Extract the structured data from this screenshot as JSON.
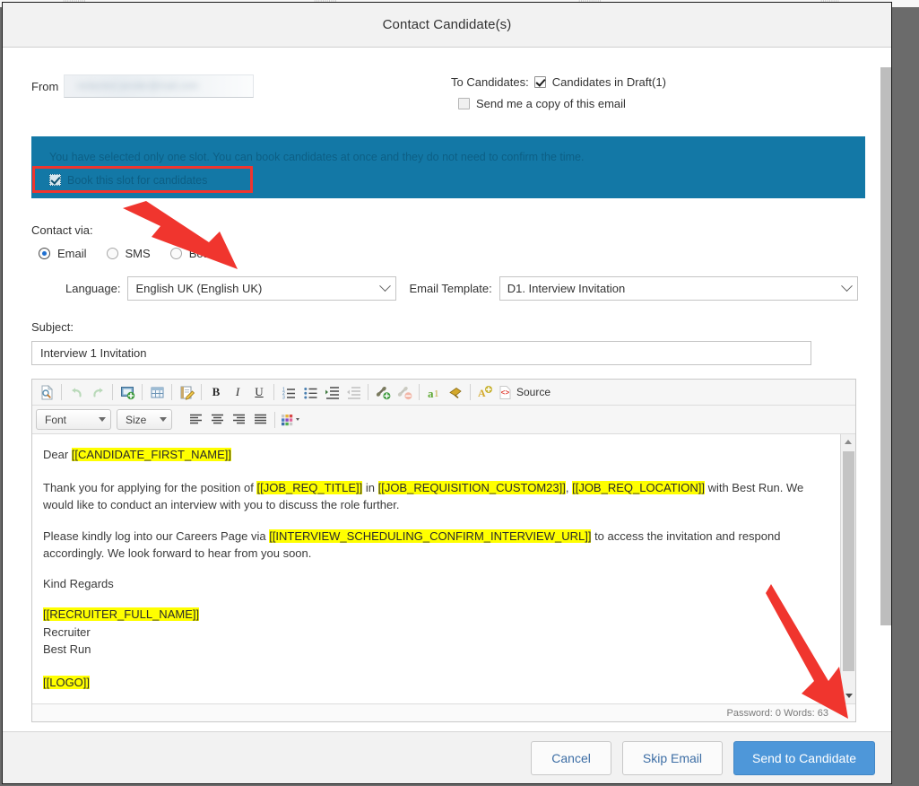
{
  "modal": {
    "title": "Contact Candidate(s)"
  },
  "from": {
    "label": "From",
    "value_redacted": "redacted.sender@mail.com"
  },
  "recipients": {
    "to_label": "To Candidates:",
    "candidates_option": "Candidates in Draft(1)",
    "candidates_checked": true,
    "copy_option": "Send me a copy of this email",
    "copy_checked": false
  },
  "info_banner": {
    "message": "You have selected only one slot. You can book candidates at once and they do not need to confirm the time.",
    "checkbox_label": "Book this slot for candidates",
    "checkbox_checked": true,
    "background_color": "#1378a6",
    "highlight_color": "#f0352e"
  },
  "contact_via": {
    "label": "Contact via:",
    "options": [
      {
        "label": "Email",
        "selected": true
      },
      {
        "label": "SMS",
        "selected": false
      },
      {
        "label": "Both",
        "selected": false
      }
    ]
  },
  "language": {
    "label": "Language:",
    "value": "English UK (English UK)"
  },
  "template": {
    "label": "Email Template:",
    "value": "D1. Interview Invitation"
  },
  "subject": {
    "label": "Subject:",
    "value": "Interview 1 Invitation"
  },
  "editor": {
    "toolbar_row1": [
      {
        "name": "preview-icon",
        "glyph": ""
      },
      {
        "name": "undo-icon",
        "glyph": ""
      },
      {
        "name": "redo-icon",
        "glyph": ""
      },
      {
        "name": "insert-image-icon",
        "glyph": ""
      },
      {
        "name": "insert-table-icon",
        "glyph": ""
      },
      {
        "name": "edit-template-icon",
        "glyph": ""
      },
      {
        "name": "bold-icon",
        "glyph": "B"
      },
      {
        "name": "italic-icon",
        "glyph": "I"
      },
      {
        "name": "underline-icon",
        "glyph": "U"
      },
      {
        "name": "numbered-list-icon",
        "glyph": ""
      },
      {
        "name": "bulleted-list-icon",
        "glyph": ""
      },
      {
        "name": "increase-indent-icon",
        "glyph": ""
      },
      {
        "name": "decrease-indent-icon",
        "glyph": ""
      },
      {
        "name": "insert-link-icon",
        "glyph": ""
      },
      {
        "name": "unlink-icon",
        "glyph": ""
      },
      {
        "name": "anchor-icon",
        "glyph": ""
      },
      {
        "name": "paste-icon",
        "glyph": ""
      },
      {
        "name": "spell-check-icon",
        "glyph": ""
      }
    ],
    "source_label": "Source",
    "font_label": "Font",
    "size_label": "Size",
    "status_text": "Password: 0 Words: 63",
    "body": {
      "greeting_prefix": "Dear ",
      "greeting_token": "[[CANDIDATE_FIRST_NAME]]",
      "para2_a": "Thank you for applying for the position of ",
      "para2_token1": "[[JOB_REQ_TITLE]]",
      "para2_b": " in ",
      "para2_token2": "[[JOB_REQUISITION_CUSTOM23]]",
      "para2_c": ",  ",
      "para2_token3": "[[JOB_REQ_LOCATION]]",
      "para2_d": " with Best Run. We would like to conduct an interview with you to discuss the role further.",
      "para3_a": "Please kindly log into our Careers Page via ",
      "para3_token": "[[INTERVIEW_SCHEDULING_CONFIRM_INTERVIEW_URL]]",
      "para3_b": " to access the invitation and respond accordingly. We look forward to hear from you soon.",
      "signoff": "Kind Regards",
      "recruiter_token": "[[RECRUITER_FULL_NAME]]",
      "role_line": "Recruiter",
      "company_line": "Best Run",
      "logo_token": "[[LOGO]]"
    }
  },
  "footer": {
    "cancel_label": "Cancel",
    "skip_label": "Skip Email",
    "send_label": "Send to Candidate",
    "send_color": "#4e97d9"
  }
}
